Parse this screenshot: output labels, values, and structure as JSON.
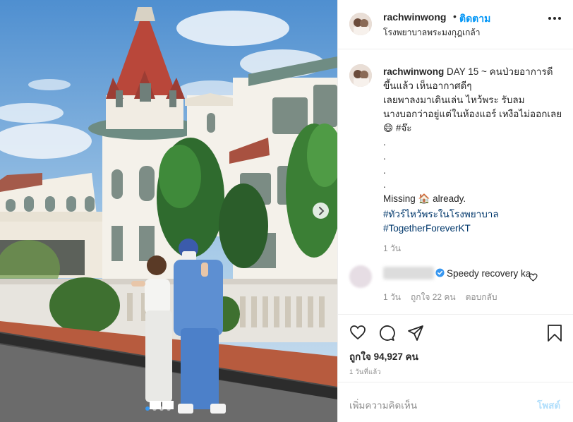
{
  "header": {
    "username": "rachwinwong",
    "separator": "•",
    "follow_label": "ติดตาม",
    "location": "โรงพยาบาลพระมงกุฎเกล้า"
  },
  "caption": {
    "username": "rachwinwong",
    "body": " DAY 15 ~ คนป่วยอาการดีขึ้นแล้ว เห็นอากาศดีๆ\nเลยพาลงมาเดินเล่น ไหว้พระ รับลม\nนางบอกว่าอยู่แต่ในห้องแอร์ เหงือไม่ออกเลย 😄 #จ๊ะ\n.\n.\n.\n.\nMissing 🏠 already.",
    "hashtags": [
      "#ทัวร์ไหว้พระในโรงพยาบาล",
      "#TogetherForeverKT"
    ],
    "time": "1 วัน"
  },
  "comment": {
    "text": "Speedy recovery ka",
    "time": "1 วัน",
    "likes": "ถูกใจ 22 คน",
    "reply_label": "ตอบกลับ"
  },
  "actions": {
    "likes": "ถูกใจ 94,927 คน",
    "date": "1 วันที่แล้ว"
  },
  "add_comment": {
    "placeholder": "เพิ่มความคิดเห็น",
    "post_label": "โพสต์"
  },
  "carousel": {
    "count": 4,
    "active": 0
  },
  "colors": {
    "link": "#0095f6",
    "hashtag": "#00376b",
    "muted": "#8e8e8e",
    "verified": "#3897f0"
  }
}
